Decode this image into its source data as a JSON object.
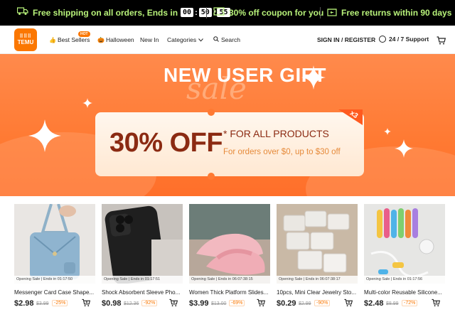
{
  "promo_bar": {
    "shipping_text": "Free shipping on all orders, Ends in",
    "timer": [
      "00",
      "50",
      "55"
    ],
    "coupon_text": "30% off coupon for you",
    "returns_text": "Free returns within 90 days",
    "accent_color": "#b8f27a"
  },
  "header": {
    "logo_top": "⠿⠿⠿",
    "logo_bottom": "TEMU",
    "nav": {
      "best_sellers": "Best Sellers",
      "hot_badge": "HOT",
      "halloween": "Halloween",
      "new_in": "New In",
      "categories": "Categories",
      "search": "Search"
    },
    "sign_in": "SIGN IN / REGISTER",
    "support": "24 / 7 Support",
    "brand_color": "#fb7701"
  },
  "banner": {
    "title": "NEW USER GIFT",
    "script_text": "sale",
    "discount": "30% OFF",
    "for_all": "* FOR ALL PRODUCTS",
    "terms": "For orders over $0, up to $30 off",
    "multiplier": "x3"
  },
  "products": [
    {
      "tag": "Opening Sale | Ends in 01:17:50",
      "name": "Messenger Card Case Shape...",
      "price": "$2.98",
      "old_price": "$3.99",
      "discount": "-25%"
    },
    {
      "tag": "Opening Sale | Ends in 01:17:51",
      "name": "Shock Absorbent Sleeve Pho...",
      "price": "$0.98",
      "old_price": "$12.36",
      "discount": "-92%"
    },
    {
      "tag": "Opening Sale | Ends in 06:07:38:15",
      "name": "Women Thick Platform Slides...",
      "price": "$3.99",
      "old_price": "$13.00",
      "discount": "-69%"
    },
    {
      "tag": "Opening Sale | Ends in 06:07:38:17",
      "name": "10pcs, Mini Clear Jewelry Sto...",
      "price": "$0.29",
      "old_price": "$2.99",
      "discount": "-90%"
    },
    {
      "tag": "Opening Sale | Ends in 01:17:56",
      "name": "Multi-color Reusable Silicone...",
      "price": "$2.48",
      "old_price": "$8.99",
      "discount": "-72%"
    }
  ]
}
